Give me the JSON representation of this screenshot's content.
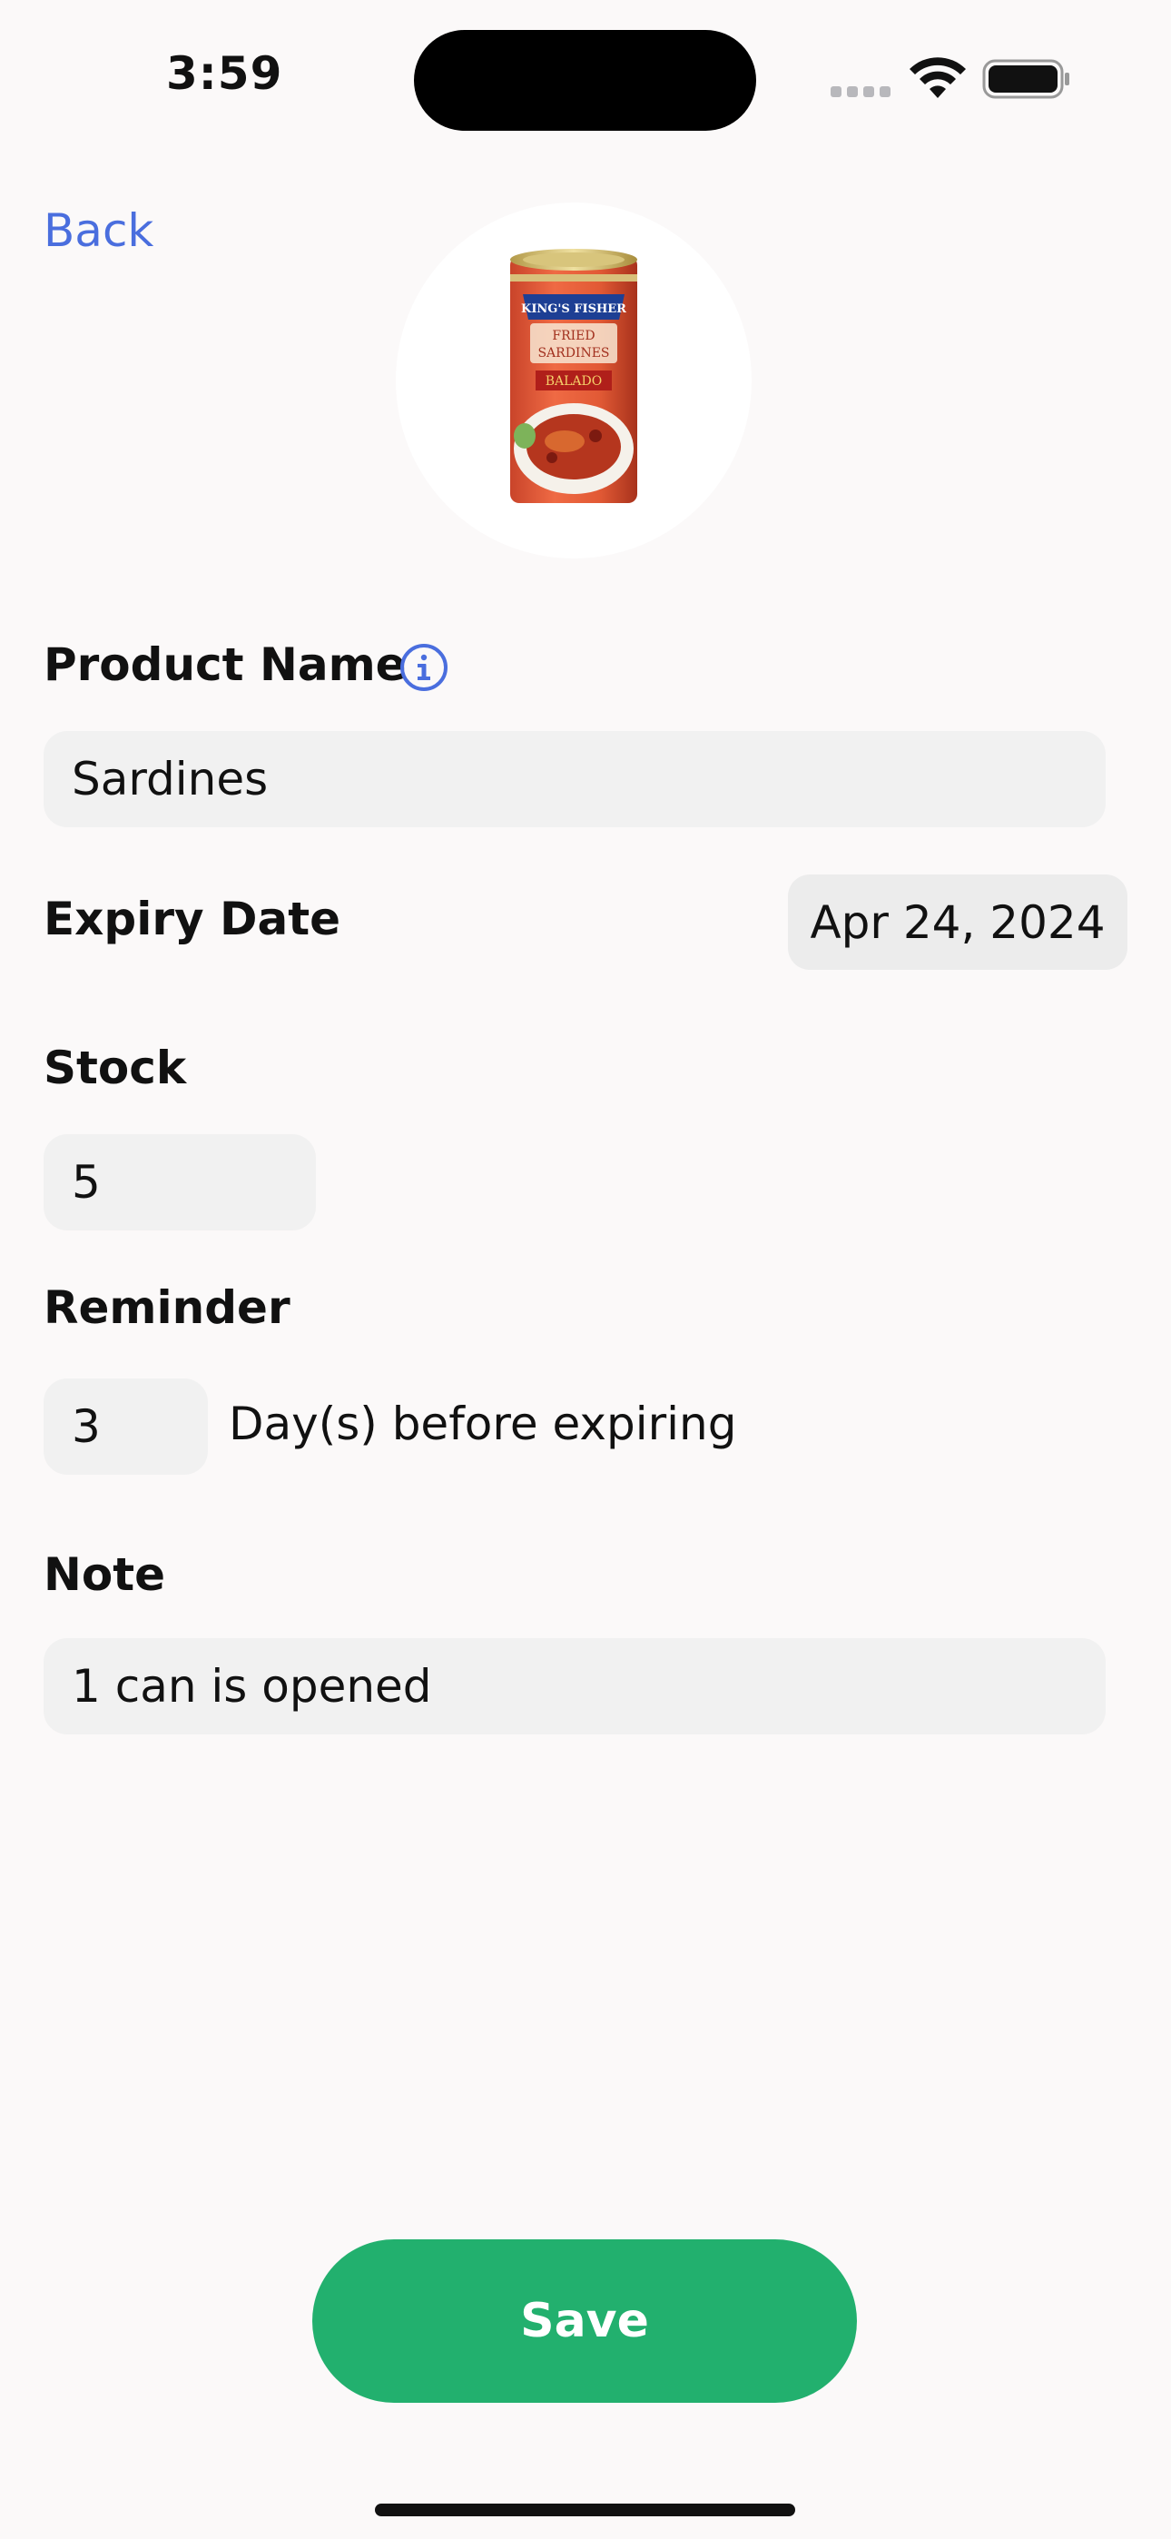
{
  "status_bar": {
    "time": "3:59"
  },
  "nav": {
    "back_label": "Back"
  },
  "product_image": {
    "icon": "sardine-can-image",
    "brand": "KING'S FISHER",
    "line1": "FRIED",
    "line2": "SARDINES",
    "flavor": "BALADO"
  },
  "form": {
    "product_name_label": "Product Name",
    "product_name_value": "Sardines",
    "expiry_label": "Expiry Date",
    "expiry_value": "Apr 24, 2024",
    "stock_label": "Stock",
    "stock_value": "5",
    "reminder_label": "Reminder",
    "reminder_value": "3",
    "reminder_suffix": "Day(s) before expiring",
    "note_label": "Note",
    "note_value": "1 can is opened"
  },
  "actions": {
    "save_label": "Save"
  },
  "colors": {
    "accent_blue": "#4a6ede",
    "save_green": "#22b06e",
    "background": "#fbf9f9",
    "field_bg": "#f1f1f1"
  }
}
